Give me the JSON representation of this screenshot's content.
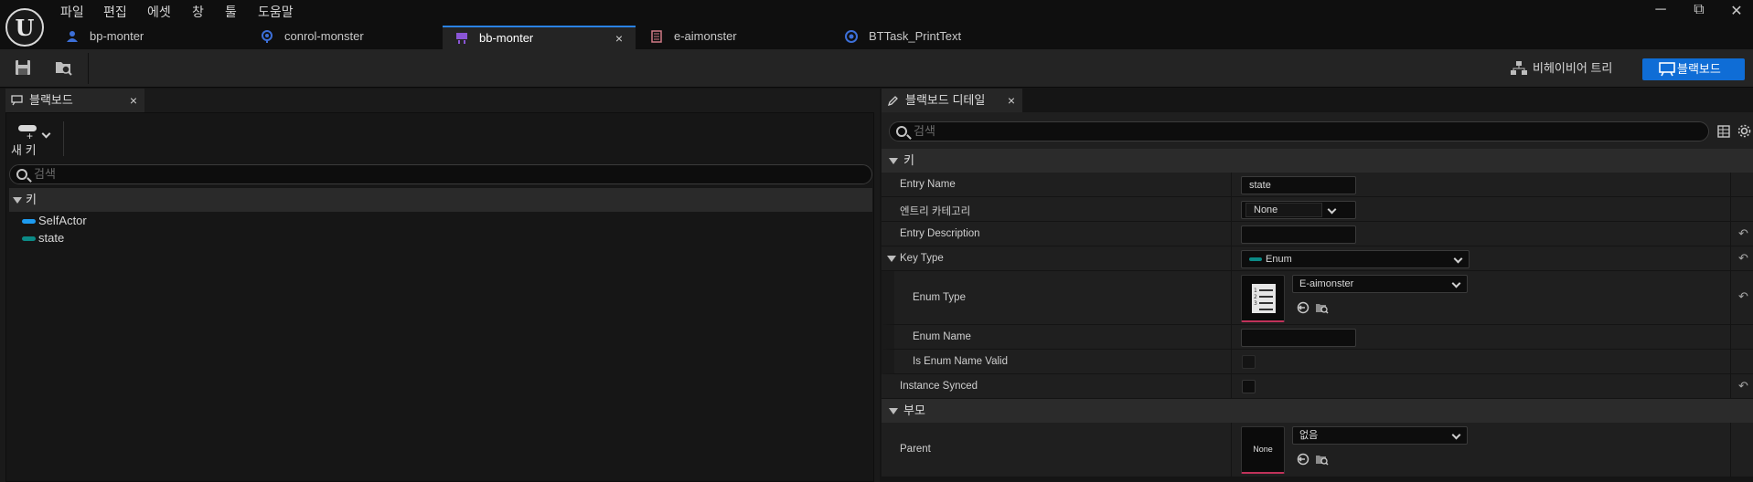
{
  "menu": [
    "파일",
    "편집",
    "에셋",
    "창",
    "툴",
    "도움말"
  ],
  "window_controls": {
    "minimize": "─",
    "restore": "⧉",
    "close": "✕"
  },
  "tabs": [
    {
      "label": "bp-monter",
      "icon": "blueprint-icon",
      "active": false
    },
    {
      "label": "conrol-monster",
      "icon": "ai-controller-icon",
      "active": false
    },
    {
      "label": "bb-monter",
      "icon": "blackboard-icon",
      "active": true,
      "close": "×"
    },
    {
      "label": "e-aimonster",
      "icon": "enum-icon",
      "active": false
    },
    {
      "label": "BTTask_PrintText",
      "icon": "bt-task-icon",
      "active": false
    }
  ],
  "toolbar": {
    "behavior_tree_label": "비헤이비어 트리",
    "blackboard_label": "블랙보드"
  },
  "left_panel": {
    "tab_label": "블랙보드",
    "tab_close": "×",
    "new_key_label": "새 키",
    "search_placeholder": "검색",
    "category_label": "키",
    "keys": [
      {
        "name": "SelfActor",
        "color": "#1d9bf0"
      },
      {
        "name": "state",
        "color": "#0b8a86"
      }
    ]
  },
  "right_panel": {
    "tab_label": "블랙보드 디테일",
    "tab_close": "×",
    "search_placeholder": "검색",
    "section_key": "키",
    "entry_name_label": "Entry Name",
    "entry_name_value": "state",
    "entry_category_label": "엔트리 카테고리",
    "entry_category_value": "None",
    "entry_description_label": "Entry Description",
    "entry_description_value": "",
    "key_type_label": "Key Type",
    "key_type_value": "Enum",
    "key_type_color": "#0b8a86",
    "enum_type_label": "Enum Type",
    "enum_type_value": "E-aimonster",
    "enum_name_label": "Enum Name",
    "enum_name_value": "",
    "is_enum_name_valid_label": "Is Enum Name Valid",
    "is_enum_name_valid": false,
    "instance_synced_label": "Instance Synced",
    "instance_synced": false,
    "section_parent": "부모",
    "parent_label": "Parent",
    "parent_thumb_text": "None",
    "parent_value": "없음",
    "accent_color": "#c0325a"
  }
}
